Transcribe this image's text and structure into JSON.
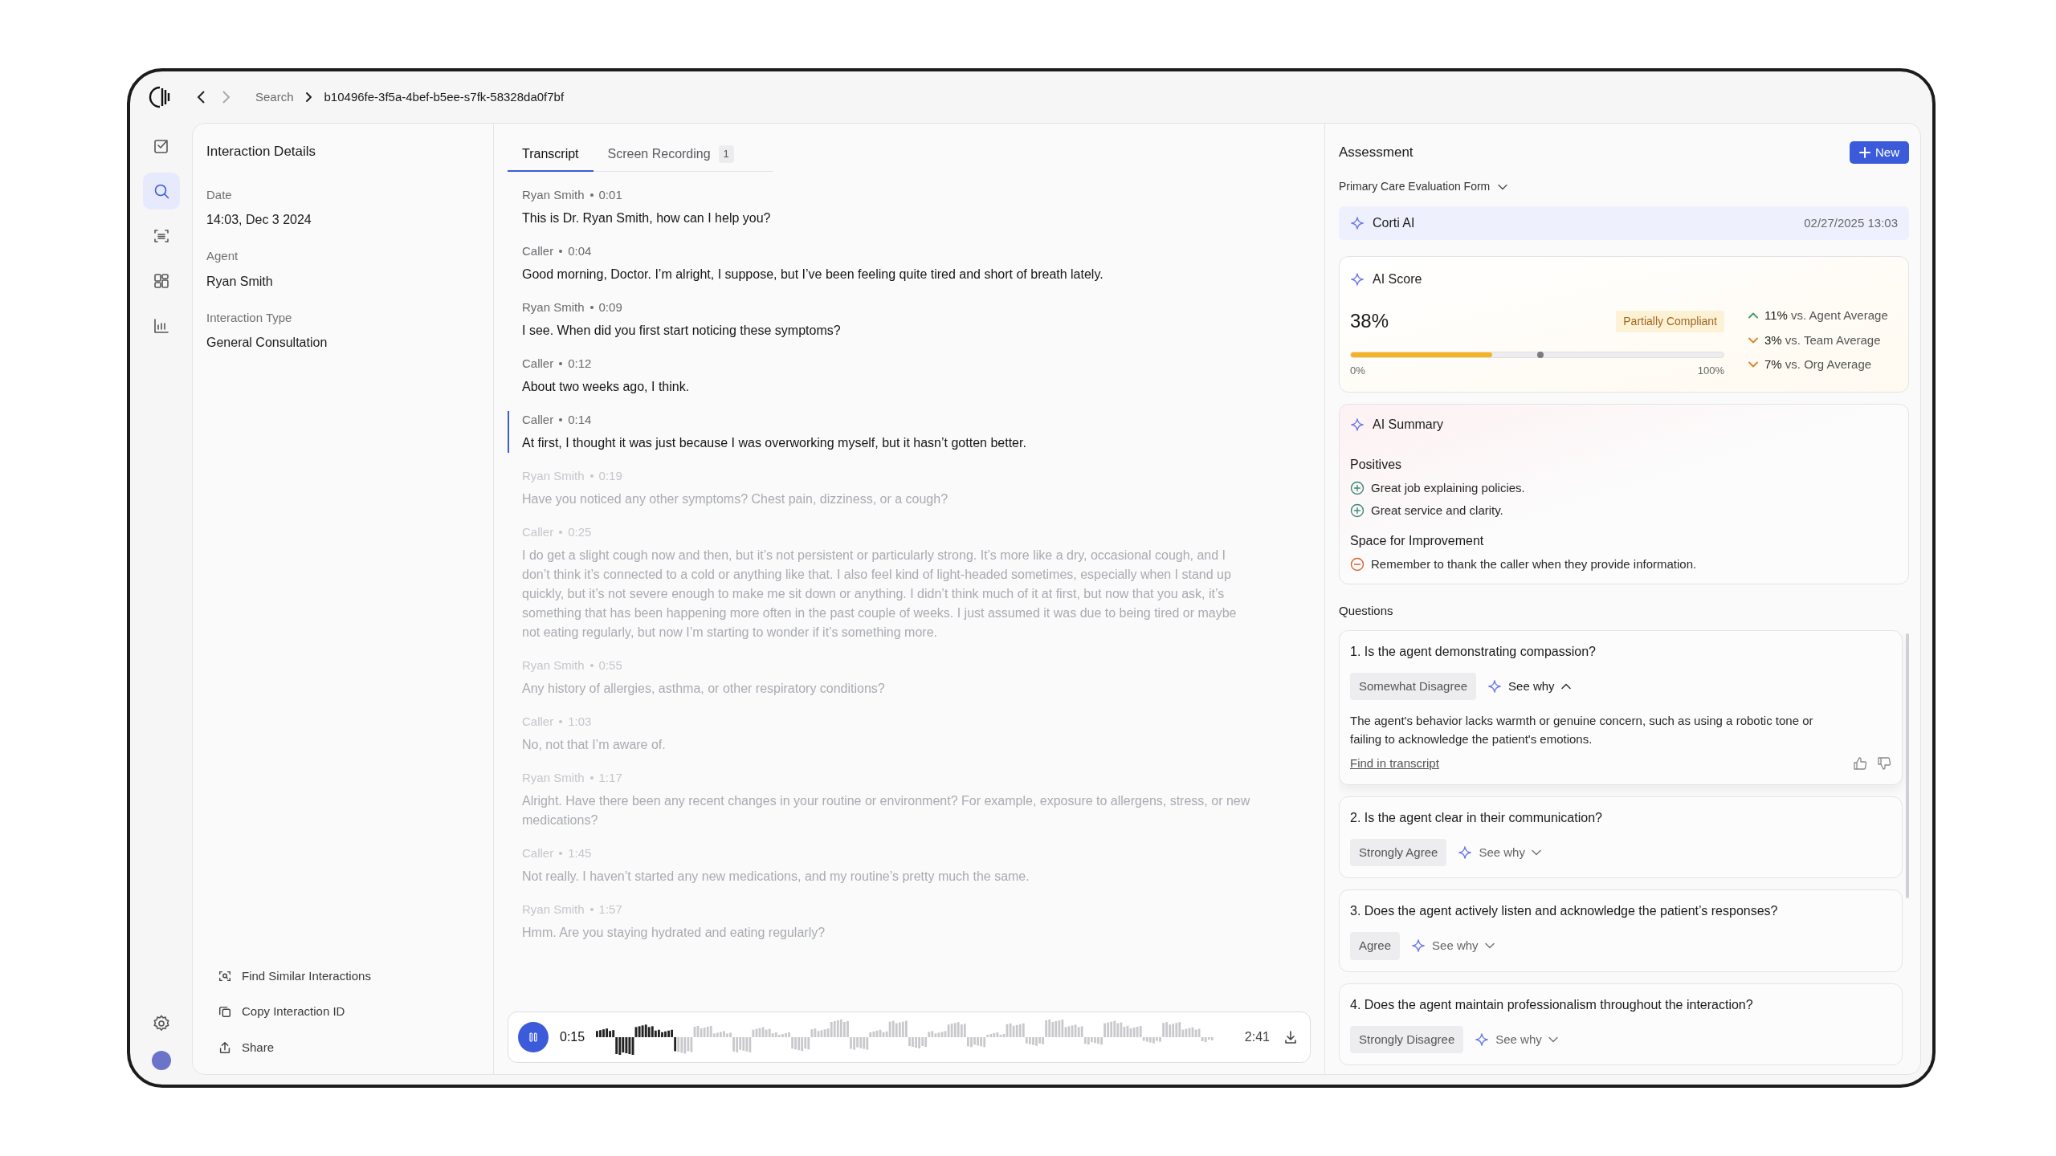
{
  "breadcrumb": {
    "items": [
      "Search",
      "b10496fe-3f5a-4bef-b5ee-s7fk-58328da0f7bf"
    ]
  },
  "rail": {
    "items": [
      {
        "kind": "tasks",
        "selected": false
      },
      {
        "kind": "search",
        "selected": true
      },
      {
        "kind": "scan",
        "selected": false
      },
      {
        "kind": "grid",
        "selected": false
      },
      {
        "kind": "chart",
        "selected": false
      }
    ]
  },
  "details": {
    "title": "Interaction Details",
    "fields": [
      {
        "label": "Date",
        "value": "14:03, Dec 3 2024"
      },
      {
        "label": "Agent",
        "value": "Ryan Smith"
      },
      {
        "label": "Interaction Type",
        "value": "General Consultation"
      }
    ],
    "actions": [
      {
        "kind": "find",
        "label": "Find Similar Interactions"
      },
      {
        "kind": "copy",
        "label": "Copy Interaction ID"
      },
      {
        "kind": "share",
        "label": "Share"
      }
    ]
  },
  "tabs": [
    {
      "label": "Transcript",
      "selected": true
    },
    {
      "label": "Screen Recording",
      "selected": false,
      "count": "1"
    }
  ],
  "transcript": [
    {
      "speaker": "Ryan Smith",
      "time": "0:01",
      "text": "This is Dr. Ryan Smith, how can I help you?",
      "played": true,
      "current": false
    },
    {
      "speaker": "Caller",
      "time": "0:04",
      "text": "Good morning, Doctor. I’m alright, I suppose, but I’ve been feeling quite tired and short of breath lately.",
      "played": true,
      "current": false
    },
    {
      "speaker": "Ryan Smith",
      "time": "0:09",
      "text": "I see. When did you first start noticing these symptoms?",
      "played": true,
      "current": false
    },
    {
      "speaker": "Caller",
      "time": "0:12",
      "text": "About two weeks ago, I think.",
      "played": true,
      "current": false
    },
    {
      "speaker": "Caller",
      "time": "0:14",
      "text": "At first, I thought it was just because I was overworking myself, but it hasn’t gotten better.",
      "played": true,
      "current": true
    },
    {
      "speaker": "Ryan Smith",
      "time": "0:19",
      "text": "Have you noticed any other symptoms? Chest pain, dizziness, or a cough?",
      "played": false,
      "current": false
    },
    {
      "speaker": "Caller",
      "time": "0:25",
      "text": "I do get a slight cough now and then, but it’s not persistent or particularly strong. It’s more like a dry, occasional cough, and I don’t think it’s connected to a cold or anything like that. I also feel kind of light-headed sometimes, especially when I stand up quickly, but it’s not severe enough to make me sit down or anything. I didn’t think much of it at first, but now that you ask, it’s something that has been happening more often in the past couple of weeks. I just assumed it was due to being tired or maybe not eating regularly, but now I’m starting to wonder if it’s something more.",
      "played": false,
      "current": false
    },
    {
      "speaker": "Ryan Smith",
      "time": "0:55",
      "text": "Any history of allergies, asthma, or other respiratory conditions?",
      "played": false,
      "current": false
    },
    {
      "speaker": "Caller",
      "time": "1:03",
      "text": "No, not that I’m aware of.",
      "played": false,
      "current": false
    },
    {
      "speaker": "Ryan Smith",
      "time": "1:17",
      "text": "Alright. Have there been any recent changes in your routine or environment? For example, exposure to allergens, stress, or new medications?",
      "played": false,
      "current": false
    },
    {
      "speaker": "Caller",
      "time": "1:45",
      "text": "Not really. I haven’t started any new medications, and my routine’s pretty much the same.",
      "played": false,
      "current": false
    },
    {
      "speaker": "Ryan Smith",
      "time": "1:57",
      "text": "Hmm. Are you staying hydrated and eating regularly?",
      "played": false,
      "current": false
    }
  ],
  "player": {
    "playing": true,
    "elapsed": "0:15",
    "duration": "2:41",
    "level": 0.13
  },
  "assessment": {
    "title": "Assessment",
    "new_button": "New",
    "form": "Primary Care Evaluation Form",
    "evaluator": "Corti AI",
    "evaluated_at": "02/27/2025 13:03",
    "score": {
      "title": "AI Score",
      "value": "38%",
      "status": "Partially Compliant",
      "level": 0.38,
      "min_label": "0%",
      "max_label": "100%",
      "comparisons": [
        {
          "increase": true,
          "value": "11%",
          "label": "vs. Agent Average"
        },
        {
          "increase": false,
          "value": "3%",
          "label": "vs. Team Average"
        },
        {
          "increase": false,
          "value": "7%",
          "label": "vs. Org Average"
        }
      ]
    },
    "summary": {
      "title": "AI Summary",
      "sections": [
        {
          "kind": "positive",
          "heading": "Positives",
          "items": [
            "Great job explaining policies.",
            "Great service and clarity."
          ]
        },
        {
          "kind": "negative",
          "heading": "Space for Improvement",
          "items": [
            "Remember to thank the caller when they provide information."
          ]
        }
      ]
    },
    "questions_title": "Questions",
    "questions": [
      {
        "question": "1. Is the agent demonstrating compassion?",
        "answer": "Somewhat Disagree",
        "see_why": "See why",
        "expanded": true,
        "explanation": "The agent's behavior lacks warmth or genuine concern, such as using a robotic tone or failing to acknowledge the patient's emotions.",
        "link": "Find in transcript"
      },
      {
        "question": "2. Is the agent clear in their communication?",
        "answer": "Strongly Agree",
        "see_why": "See why",
        "expanded": false
      },
      {
        "question": "3. Does the agent actively listen and acknowledge the patient’s responses?",
        "answer": "Agree",
        "see_why": "See why",
        "expanded": false
      },
      {
        "question": "4. Does the agent maintain professionalism throughout the interaction?",
        "answer": "Strongly Disagree",
        "see_why": "See why",
        "expanded": false
      }
    ]
  }
}
